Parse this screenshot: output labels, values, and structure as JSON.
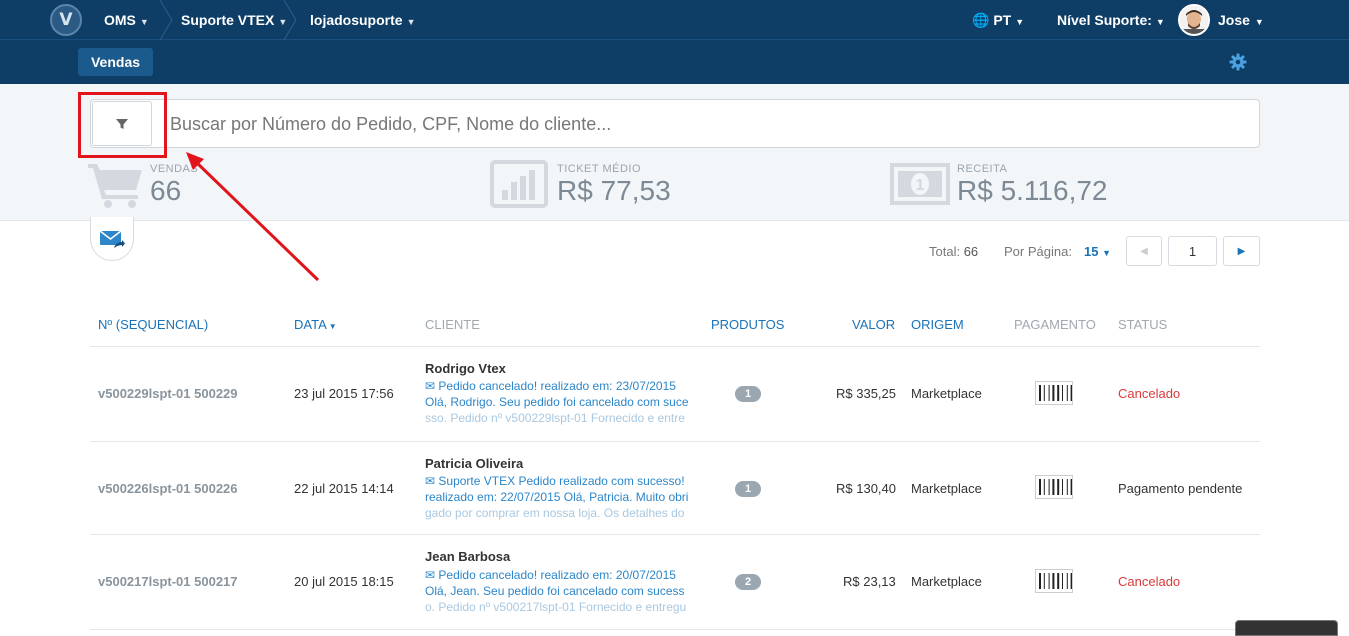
{
  "topbar": {
    "logo": "V",
    "crumbs": [
      "OMS",
      "Suporte VTEX",
      "lojadosuporte"
    ],
    "language": "PT",
    "support_level": "Nível Suporte:",
    "user": "Jose"
  },
  "subbar": {
    "tab": "Vendas"
  },
  "search": {
    "placeholder": "Buscar por Número do Pedido, CPF, Nome do cliente..."
  },
  "stats": [
    {
      "label": "VENDAS",
      "value": "66"
    },
    {
      "label": "TICKET MÉDIO",
      "value": "R$ 77,53"
    },
    {
      "label": "RECEITA",
      "value": "R$ 5.116,72"
    }
  ],
  "pagination": {
    "total_label": "Total:",
    "total": "66",
    "per_page_label": "Por Página:",
    "per_page": "15",
    "page": "1"
  },
  "table": {
    "headers": [
      "Nº (SEQUENCIAL)",
      "DATA",
      "CLIENTE",
      "PRODUTOS",
      "VALOR",
      "ORIGEM",
      "PAGAMENTO",
      "STATUS"
    ],
    "rows": [
      {
        "id": "v500229lspt-01 500229",
        "date": "23 jul 2015 17:56",
        "client": "Rodrigo Vtex",
        "msg1": "Pedido cancelado! realizado em: 23/07/2015",
        "msg2": "Olá, Rodrigo. Seu pedido foi cancelado com suce",
        "msg3": "sso. Pedido nº v500229lspt-01 Fornecido e entre",
        "products": "1",
        "value": "R$ 335,25",
        "origin": "Marketplace",
        "status": "Cancelado",
        "status_color": "#d93b3b"
      },
      {
        "id": "v500226lspt-01 500226",
        "date": "22 jul 2015 14:14",
        "client": "Patricia Oliveira",
        "msg1": "Suporte VTEX Pedido realizado com sucesso!",
        "msg2": "realizado em: 22/07/2015 Olá, Patricia. Muito obri",
        "msg3": "gado por comprar em nossa loja. Os detalhes do",
        "products": "1",
        "value": "R$ 130,40",
        "origin": "Marketplace",
        "status": "Pagamento pendente",
        "status_color": "#333333"
      },
      {
        "id": "v500217lspt-01 500217",
        "date": "20 jul 2015 18:15",
        "client": "Jean Barbosa",
        "msg1": "Pedido cancelado! realizado em: 20/07/2015",
        "msg2": "Olá, Jean. Seu pedido foi cancelado com sucess",
        "msg3": "o. Pedido nº v500217lspt-01 Fornecido e entregu",
        "products": "2",
        "value": "R$ 23,13",
        "origin": "Marketplace",
        "status": "Cancelado",
        "status_color": "#d93b3b"
      }
    ]
  },
  "colors": {
    "header": "#0e3d66",
    "accent": "#1a73b8",
    "highlight": "#e0141a"
  }
}
